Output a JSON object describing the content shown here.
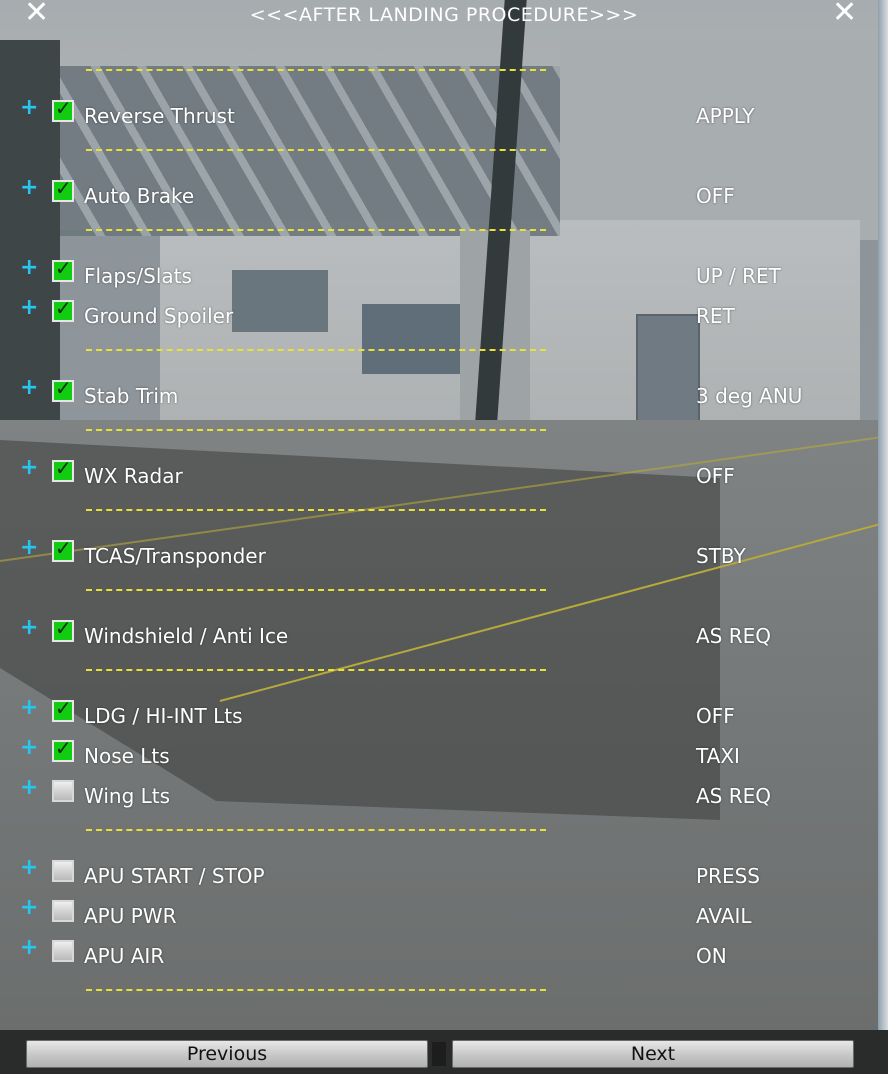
{
  "header": {
    "title": "<<<AFTER LANDING PROCEDURE>>>",
    "close_left": "✕",
    "close_right": "✕"
  },
  "items": [
    {
      "label": "Reverse Thrust",
      "value": "APPLY",
      "checked": true,
      "divider_before": true
    },
    {
      "label": "Auto Brake",
      "value": "OFF",
      "checked": true,
      "divider_before": true
    },
    {
      "label": "Flaps/Slats",
      "value": "UP / RET",
      "checked": true,
      "divider_before": true
    },
    {
      "label": "Ground Spoiler",
      "value": "RET",
      "checked": true,
      "divider_before": false
    },
    {
      "label": "Stab Trim",
      "value": "3 deg ANU",
      "checked": true,
      "divider_before": true
    },
    {
      "label": "WX Radar",
      "value": "OFF",
      "checked": true,
      "divider_before": true
    },
    {
      "label": "TCAS/Transponder",
      "value": "STBY",
      "checked": true,
      "divider_before": true
    },
    {
      "label": "Windshield / Anti Ice",
      "value": "AS REQ",
      "checked": true,
      "divider_before": true
    },
    {
      "label": "LDG / HI-INT Lts",
      "value": "OFF",
      "checked": true,
      "divider_before": true
    },
    {
      "label": "Nose Lts",
      "value": "TAXI",
      "checked": true,
      "divider_before": false
    },
    {
      "label": "Wing Lts",
      "value": "AS REQ",
      "checked": false,
      "divider_before": false
    },
    {
      "label": "APU START / STOP",
      "value": "PRESS",
      "checked": false,
      "divider_before": true
    },
    {
      "label": "APU PWR",
      "value": "AVAIL",
      "checked": false,
      "divider_before": false
    },
    {
      "label": "APU AIR",
      "value": "ON",
      "checked": false,
      "divider_before": false
    }
  ],
  "trailing_divider": true,
  "icons": {
    "expand": "+",
    "check": "✓"
  },
  "footer": {
    "previous_label": "Previous",
    "next_label": "Next"
  },
  "colors": {
    "divider": "#e8e13a",
    "expand_icon": "#27c5f0",
    "checkbox_on": "#11cc11",
    "text": "#ffffff"
  }
}
